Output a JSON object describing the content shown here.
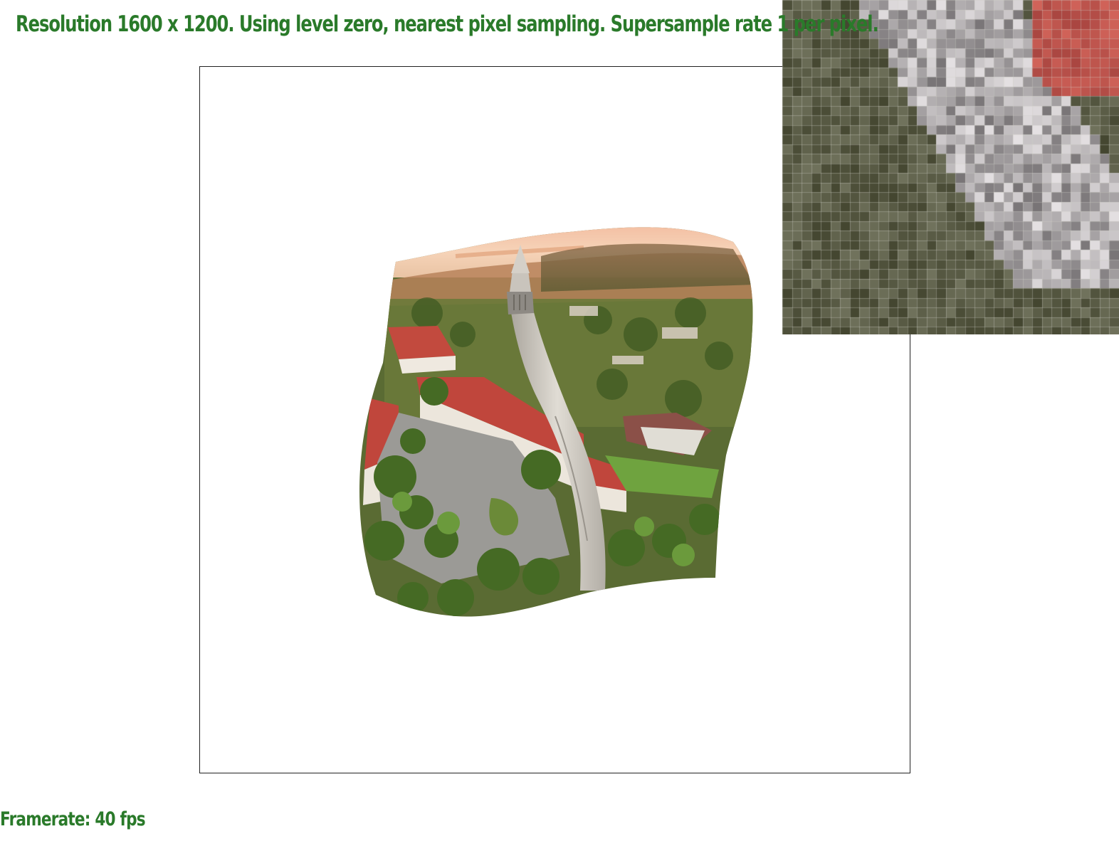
{
  "hud": {
    "title": "Resolution 1600 x 1200. Using level zero, nearest pixel sampling. Supersample rate 1 per pixel.",
    "framerate": "Framerate: 40 fps"
  },
  "colors": {
    "hud_text": "#2a7a2a",
    "frame_border": "#222222",
    "sky": "#f3c3a3",
    "roof_red": "#c0483e",
    "tower_stone": "#cfcac2",
    "foliage": "#4f6b2c",
    "plaza_gray": "#9a9a96",
    "lawn_green": "#6fa03e"
  },
  "scene": {
    "description_icon": "warped-texture-image-icon",
    "zoom_icon": "pixel-zoom-inset-icon"
  }
}
